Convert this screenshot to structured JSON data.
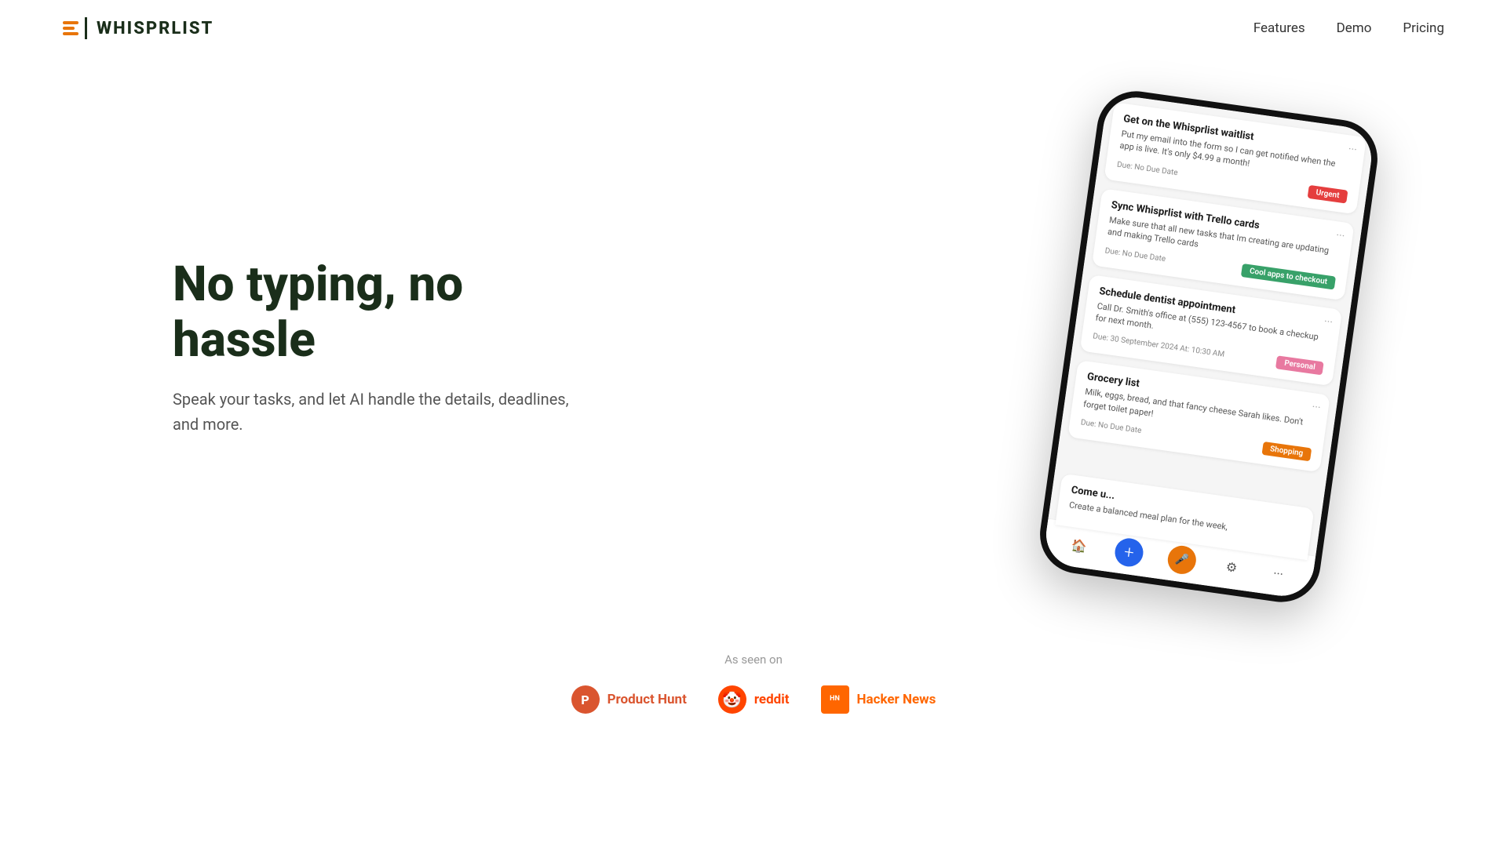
{
  "navbar": {
    "logo_text": "WHISPRLIST",
    "links": [
      {
        "label": "Features",
        "href": "#"
      },
      {
        "label": "Demo",
        "href": "#"
      },
      {
        "label": "Pricing",
        "href": "#"
      }
    ]
  },
  "hero": {
    "title": "No typing, no hassle",
    "subtitle": "Speak your tasks, and let AI handle the details, deadlines, and more."
  },
  "phone": {
    "tasks": [
      {
        "title": "Get on the Whisprlist waitlist",
        "body": "Put my email into the form so I can get notified when the app is live. It's only $4.99 a month!",
        "due": "Due: No Due Date",
        "tag": "Urgent",
        "tag_class": "tag-urgent"
      },
      {
        "title": "Sync Whisprlist with Trello cards",
        "body": "Make sure that all new tasks that Im creating are updating and making Trello cards",
        "due": "Due: No Due Date",
        "tag": "Cool apps to checkout",
        "tag_class": "tag-cool"
      },
      {
        "title": "Schedule dentist appointment",
        "body": "Call Dr. Smith's office at (555) 123-4567 to book a checkup for next month.",
        "due": "Due: 30 September 2024 At: 10:30 AM",
        "tag": "Personal",
        "tag_class": "tag-personal"
      },
      {
        "title": "Grocery list",
        "body": "Milk, eggs, bread, and that fancy cheese Sarah likes. Don't forget toilet paper!",
        "due": "Due: No Due Date",
        "tag": "Shopping",
        "tag_class": "tag-shopping"
      },
      {
        "title": "Come u...",
        "body": "Create a balanced meal plan for the week,",
        "due": "",
        "tag": "",
        "tag_class": ""
      }
    ]
  },
  "as_seen_on": {
    "label": "As seen on",
    "badges": [
      {
        "name": "Product Hunt",
        "icon_text": "P",
        "class": "badge-ph",
        "icon_class": "badge-icon-ph"
      },
      {
        "name": "reddit",
        "icon_text": "🤠",
        "class": "badge-reddit",
        "icon_class": "badge-icon-reddit"
      },
      {
        "name": "Hacker News",
        "icon_text": "HN",
        "class": "badge-hn",
        "icon_class": "badge-icon-hn"
      }
    ]
  }
}
